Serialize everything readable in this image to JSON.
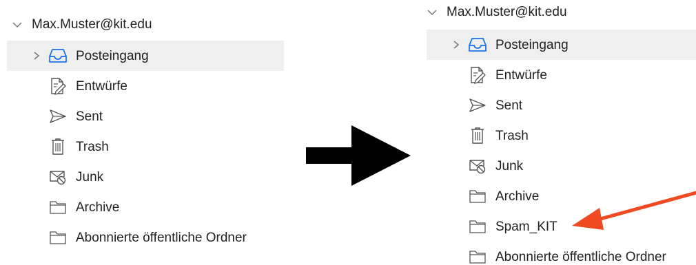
{
  "colors": {
    "selected_row": "#efefef",
    "inbox_icon": "#1a73e8",
    "icon_stroke": "#555555",
    "transition_arrow": "#000000",
    "highlight_arrow": "#f04a23"
  },
  "left_panel": {
    "account": "Max.Muster@kit.edu",
    "folders": [
      {
        "label": "Posteingang",
        "icon": "inbox-tray-icon",
        "selected": true,
        "expandable": true
      },
      {
        "label": "Entwürfe",
        "icon": "drafts-icon"
      },
      {
        "label": "Sent",
        "icon": "paper-plane-icon"
      },
      {
        "label": "Trash",
        "icon": "trash-can-icon"
      },
      {
        "label": "Junk",
        "icon": "junk-mail-icon"
      },
      {
        "label": "Archive",
        "icon": "folder-icon"
      },
      {
        "label": "Abonnierte öffentliche Ordner",
        "icon": "folder-icon"
      }
    ]
  },
  "right_panel": {
    "account": "Max.Muster@kit.edu",
    "folders": [
      {
        "label": "Posteingang",
        "icon": "inbox-tray-icon",
        "selected": true,
        "expandable": true
      },
      {
        "label": "Entwürfe",
        "icon": "drafts-icon"
      },
      {
        "label": "Sent",
        "icon": "paper-plane-icon"
      },
      {
        "label": "Trash",
        "icon": "trash-can-icon"
      },
      {
        "label": "Junk",
        "icon": "junk-mail-icon"
      },
      {
        "label": "Archive",
        "icon": "folder-icon"
      },
      {
        "label": "Spam_KIT",
        "icon": "folder-icon"
      },
      {
        "label": "Abonnierte öffentliche Ordner",
        "icon": "folder-icon"
      }
    ]
  },
  "annotations": {
    "transition_arrow_icon": "right-arrow-icon",
    "highlight_arrow_icon": "red-pointer-arrow-icon",
    "highlight_target": "Spam_KIT"
  }
}
